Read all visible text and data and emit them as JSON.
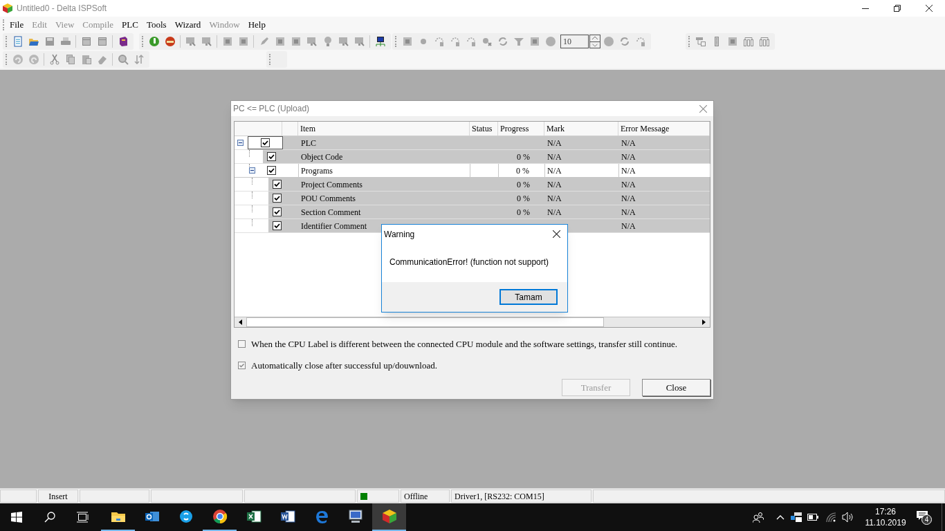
{
  "window": {
    "title": "Untitled0 - Delta ISPSoft"
  },
  "menu": [
    {
      "label": "File",
      "disabled": false
    },
    {
      "label": "Edit",
      "disabled": true
    },
    {
      "label": "View",
      "disabled": true
    },
    {
      "label": "Compile",
      "disabled": true
    },
    {
      "label": "PLC",
      "disabled": false
    },
    {
      "label": "Tools",
      "disabled": false
    },
    {
      "label": "Wizard",
      "disabled": false
    },
    {
      "label": "Window",
      "disabled": true
    },
    {
      "label": "Help",
      "disabled": false
    }
  ],
  "toolbar": {
    "spin_value": "10"
  },
  "dialog": {
    "title": "PC <= PLC (Upload)",
    "table": {
      "columns": [
        "Item",
        "Status",
        "Progress",
        "Mark",
        "Error Message"
      ],
      "rows": [
        {
          "item": "PLC",
          "checked": true,
          "expanded": true,
          "selected": false,
          "mark": "N/A",
          "error": "N/A",
          "children": [
            {
              "item": "Object Code",
              "checked": true,
              "selected": false,
              "progress": "0 %",
              "mark": "N/A",
              "error": "N/A"
            },
            {
              "item": "Programs",
              "checked": true,
              "expanded": true,
              "selected": true,
              "progress": "0 %",
              "mark": "N/A",
              "error": "N/A",
              "children": [
                {
                  "item": "Project Comments",
                  "checked": true,
                  "selected": false,
                  "progress": "0 %",
                  "mark": "N/A",
                  "error": "N/A"
                },
                {
                  "item": "POU Comments",
                  "checked": true,
                  "selected": false,
                  "progress": "0 %",
                  "mark": "N/A",
                  "error": "N/A"
                },
                {
                  "item": "Section Comment",
                  "checked": true,
                  "selected": false,
                  "progress": "0 %",
                  "mark": "N/A",
                  "error": "N/A"
                },
                {
                  "item": "Identifier Comment",
                  "checked": true,
                  "selected": false,
                  "error": "N/A"
                }
              ]
            }
          ]
        }
      ]
    },
    "options": [
      {
        "label": "When the CPU Label is different between the connected CPU module and the software settings, transfer still continue.",
        "checked": false
      },
      {
        "label": "Automatically close after successful up/douwnload.",
        "checked": true
      }
    ],
    "buttons": [
      {
        "label": "Transfer",
        "disabled": true
      },
      {
        "label": "Close",
        "disabled": false
      }
    ]
  },
  "warning": {
    "title": "Warning",
    "message": "CommunicationError! (function not support)",
    "button": "Tamam"
  },
  "status_bar": [
    {
      "kind": "blank"
    },
    {
      "kind": "text",
      "text": "Insert"
    },
    {
      "kind": "blank"
    },
    {
      "kind": "blank"
    },
    {
      "kind": "blank"
    },
    {
      "kind": "indicator",
      "color": "#008000"
    },
    {
      "kind": "text",
      "text": "Offline"
    },
    {
      "kind": "text",
      "text": "Driver1, [RS232: COM15]"
    },
    {
      "kind": "blank"
    }
  ],
  "taskbar": {
    "apps": [
      {
        "kind": "folder",
        "running": true,
        "active": false
      },
      {
        "kind": "mail",
        "running": false,
        "active": false
      },
      {
        "kind": "chat",
        "running": false,
        "active": false
      },
      {
        "kind": "browser",
        "running": true,
        "active": false
      },
      {
        "kind": "spreadsheet",
        "running": false,
        "active": false
      },
      {
        "kind": "document",
        "running": false,
        "active": false
      },
      {
        "kind": "edge",
        "running": false,
        "active": false
      },
      {
        "kind": "computer",
        "running": false,
        "active": false
      },
      {
        "kind": "cube",
        "running": true,
        "active": true
      }
    ],
    "tray": {
      "time": "17:26",
      "date": "11.10.2019",
      "notifications": "4"
    }
  }
}
